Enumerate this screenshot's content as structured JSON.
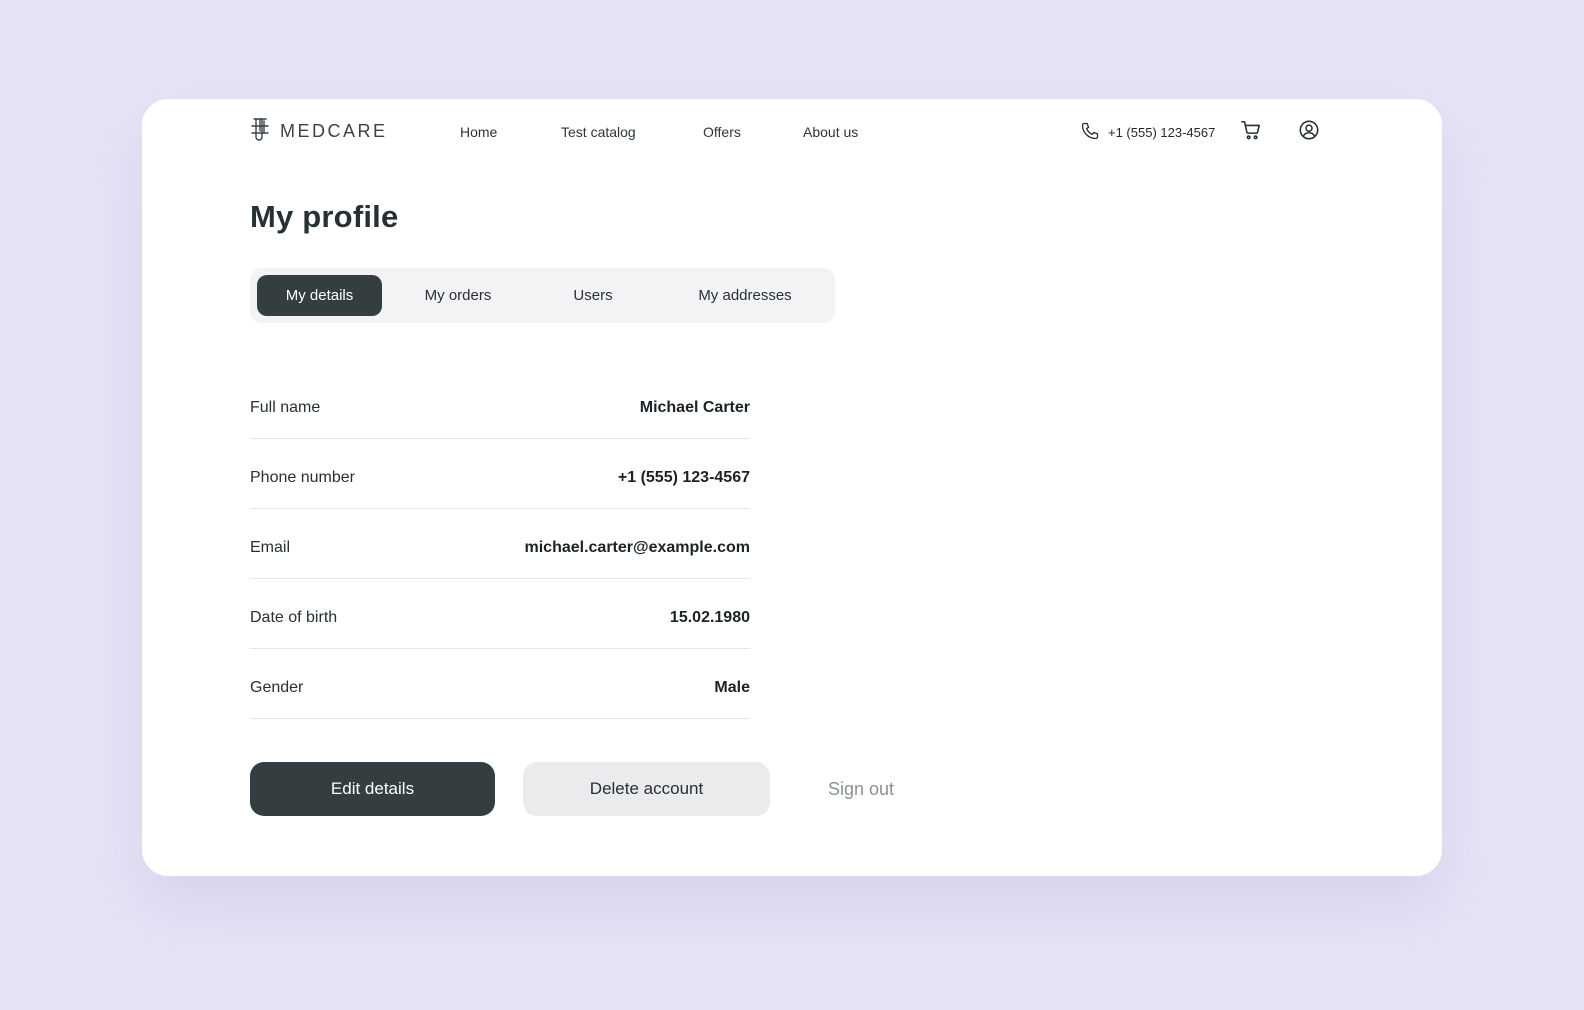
{
  "brand": {
    "name": "MEDCARE",
    "logo_icon": "test-tubes-logo-icon"
  },
  "nav": {
    "items": [
      "Home",
      "Test catalog",
      "Offers",
      "About us"
    ]
  },
  "contact": {
    "phone": "+1 (555) 123-4567",
    "phone_icon": "phone-icon"
  },
  "header_icons": {
    "cart": "cart-icon",
    "account": "user-circle-icon"
  },
  "page": {
    "title": "My profile"
  },
  "tabs": {
    "items": [
      "My details",
      "My orders",
      "Users",
      "My addresses"
    ],
    "active": "My details"
  },
  "details": {
    "rows": [
      {
        "label": "Full name",
        "value": "Michael Carter"
      },
      {
        "label": "Phone number",
        "value": "+1 (555) 123-4567"
      },
      {
        "label": "Email",
        "value": "michael.carter@example.com"
      },
      {
        "label": "Date of birth",
        "value": "15.02.1980"
      },
      {
        "label": "Gender",
        "value": "Male"
      }
    ]
  },
  "actions": {
    "edit_label": "Edit details",
    "delete_label": "Delete account",
    "signout_label": "Sign out"
  },
  "colors": {
    "background": "#e6e3f5",
    "card": "#ffffff",
    "primary": "#343e40",
    "secondary": "#ebebed",
    "muted_text": "#8a9195"
  }
}
